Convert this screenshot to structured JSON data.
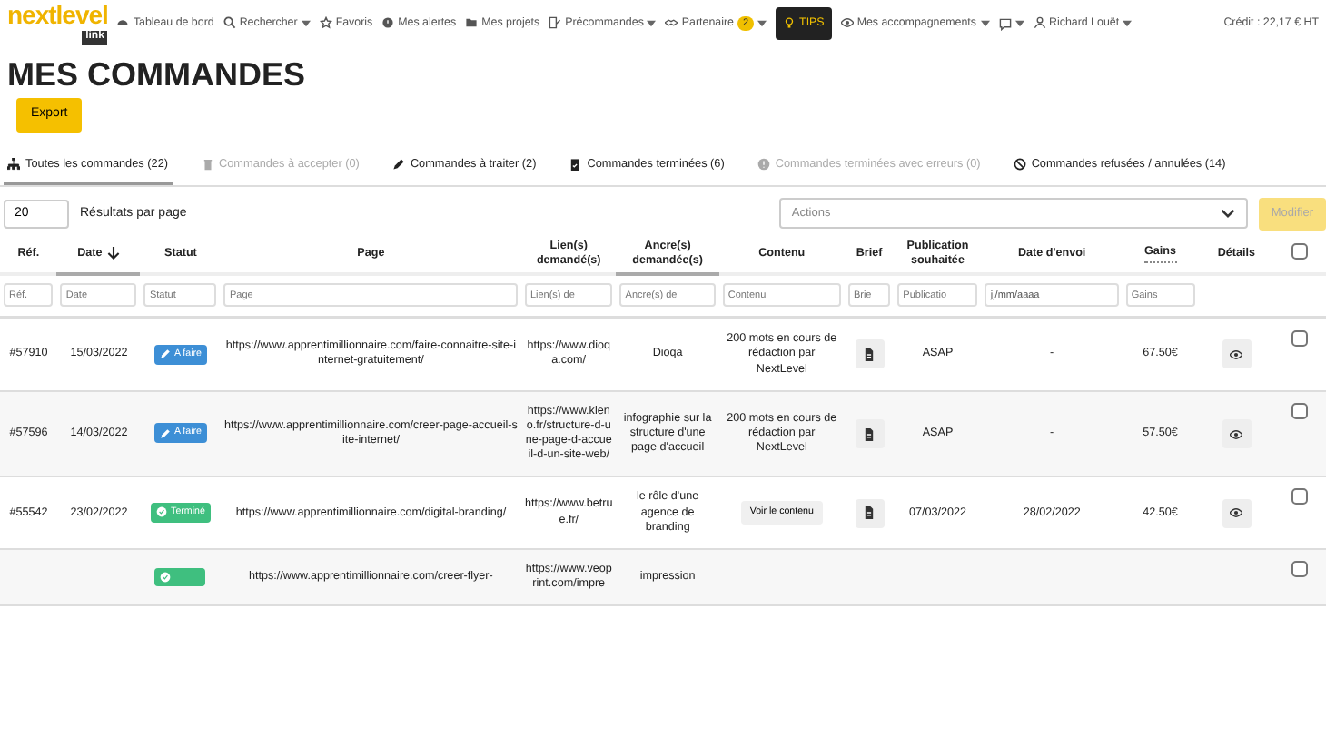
{
  "navbar": {
    "logo": {
      "word": "nextlevel",
      "tag": "link"
    },
    "items": [
      {
        "kind": "dashboard",
        "label": "Tableau de bord",
        "dropdown": false,
        "selected": false
      },
      {
        "kind": "search",
        "label": "Rechercher",
        "dropdown": true,
        "selected": false
      },
      {
        "kind": "star",
        "label": "Favoris",
        "dropdown": false,
        "selected": false
      },
      {
        "kind": "alert",
        "label": "Mes alertes",
        "dropdown": false,
        "selected": false
      },
      {
        "kind": "folder",
        "label": "Mes projets",
        "dropdown": false,
        "selected": false
      },
      {
        "kind": "preorder",
        "label": "Précommandes",
        "dropdown": true,
        "selected": false
      },
      {
        "kind": "partner",
        "label": "Partenaire",
        "badge": "2",
        "dropdown": true,
        "selected": false
      },
      {
        "kind": "bulb",
        "label": "TIPS",
        "dropdown": false,
        "selected": true
      },
      {
        "kind": "eye",
        "label": "Mes accompagnements",
        "dropdown": true,
        "selected": false
      },
      {
        "kind": "chat",
        "dropdown": true,
        "selected": false
      },
      {
        "kind": "user",
        "label": "Richard Louët",
        "dropdown": true,
        "selected": false
      }
    ],
    "credit": "Crédit : 22,17 € HT"
  },
  "title": "MES COMMANDES",
  "export_button": "Export",
  "tabs": [
    {
      "kind": "tree",
      "label": "Toutes les commandes (22)",
      "selected": true,
      "disabled": false
    },
    {
      "kind": "trash",
      "label": "Commandes à accepter (0)",
      "selected": false,
      "disabled": true
    },
    {
      "kind": "pencil",
      "label": "Commandes à traiter (2)",
      "selected": false,
      "disabled": false
    },
    {
      "kind": "clipboard",
      "label": "Commandes terminées (6)",
      "selected": false,
      "disabled": false
    },
    {
      "kind": "error",
      "label": "Commandes terminées avec erreurs (0)",
      "selected": false,
      "disabled": true
    },
    {
      "kind": "ban",
      "label": "Commandes refusées / annulées (14)",
      "selected": false,
      "disabled": false
    }
  ],
  "page_size": {
    "value": "20",
    "label": "Résultats par page"
  },
  "actions": {
    "placeholder": "Actions",
    "button": "Modifier",
    "button_disabled": true
  },
  "table": {
    "columns": [
      {
        "label": "Réf.",
        "sorted": false,
        "descending": false,
        "has_tooltip": false,
        "placeholder": "Réf."
      },
      {
        "label": "Date",
        "sorted": true,
        "descending": true,
        "has_tooltip": false,
        "placeholder": "Date"
      },
      {
        "label": "Statut",
        "sorted": false,
        "descending": false,
        "has_tooltip": false,
        "placeholder": "Statut"
      },
      {
        "label": "Page",
        "sorted": false,
        "descending": false,
        "has_tooltip": false,
        "placeholder": "Page"
      },
      {
        "label": "Lien(s) demandé(s)",
        "sorted": false,
        "descending": false,
        "has_tooltip": false,
        "placeholder": "Lien(s) de"
      },
      {
        "label": "Ancre(s) demandée(s)",
        "sorted": true,
        "descending": false,
        "has_tooltip": false,
        "placeholder": "Ancre(s) de"
      },
      {
        "label": "Contenu",
        "sorted": false,
        "descending": false,
        "has_tooltip": false,
        "placeholder": "Contenu"
      },
      {
        "label": "Brief",
        "sorted": false,
        "descending": false,
        "has_tooltip": false,
        "placeholder": "Brie"
      },
      {
        "label": "Publication souhaitée",
        "sorted": false,
        "descending": false,
        "has_tooltip": false,
        "placeholder": "Publicatio"
      },
      {
        "label": "Date d'envoi",
        "sorted": false,
        "descending": false,
        "has_tooltip": false,
        "value": "jj/mm/aaaa"
      },
      {
        "label": "Gains",
        "sorted": false,
        "descending": false,
        "has_tooltip": true,
        "placeholder": "Gains"
      },
      {
        "label": "Détails",
        "sorted": false,
        "descending": false,
        "has_tooltip": false
      }
    ],
    "select_all": false,
    "rows": [
      {
        "ref": "#57910",
        "date": "15/03/2022",
        "status": {
          "kind": "todo",
          "label": "A faire"
        },
        "page": "https://www.apprentimillionnaire.com/faire-connaitre-site-internet-gratuitement/",
        "link": "https://www.dioqa.com/",
        "anchor": "Dioqa",
        "content": {
          "kind": "text",
          "label": "200 mots en cours de rédaction par NextLevel"
        },
        "publication": "ASAP",
        "sent": "-",
        "gains": "67.50€",
        "checked": false
      },
      {
        "ref": "#57596",
        "date": "14/03/2022",
        "status": {
          "kind": "todo",
          "label": "A faire"
        },
        "page": "https://www.apprentimillionnaire.com/creer-page-accueil-site-internet/",
        "link": "https://www.kleno.fr/structure-d-une-page-d-accueil-d-un-site-web/",
        "anchor": "infographie sur la structure d'une page d'accueil",
        "content": {
          "kind": "text",
          "label": "200 mots en cours de rédaction par NextLevel"
        },
        "publication": "ASAP",
        "sent": "-",
        "gains": "57.50€",
        "checked": false
      },
      {
        "ref": "#55542",
        "date": "23/02/2022",
        "status": {
          "kind": "done",
          "label": "Terminé"
        },
        "page": "https://www.apprentimillionnaire.com/digital-branding/",
        "link": "https://www.betrue.fr/",
        "anchor": "le rôle d'une agence de branding",
        "content": {
          "kind": "button",
          "label": "Voir le contenu"
        },
        "publication": "07/03/2022",
        "sent": "28/02/2022",
        "gains": "42.50€",
        "checked": false
      },
      {
        "status": {
          "kind": "done"
        },
        "page": "https://www.apprentimillionnaire.com/creer-flyer-",
        "link": "https://www.veoprint.com/impre",
        "anchor": "impression",
        "checked": false
      }
    ]
  }
}
